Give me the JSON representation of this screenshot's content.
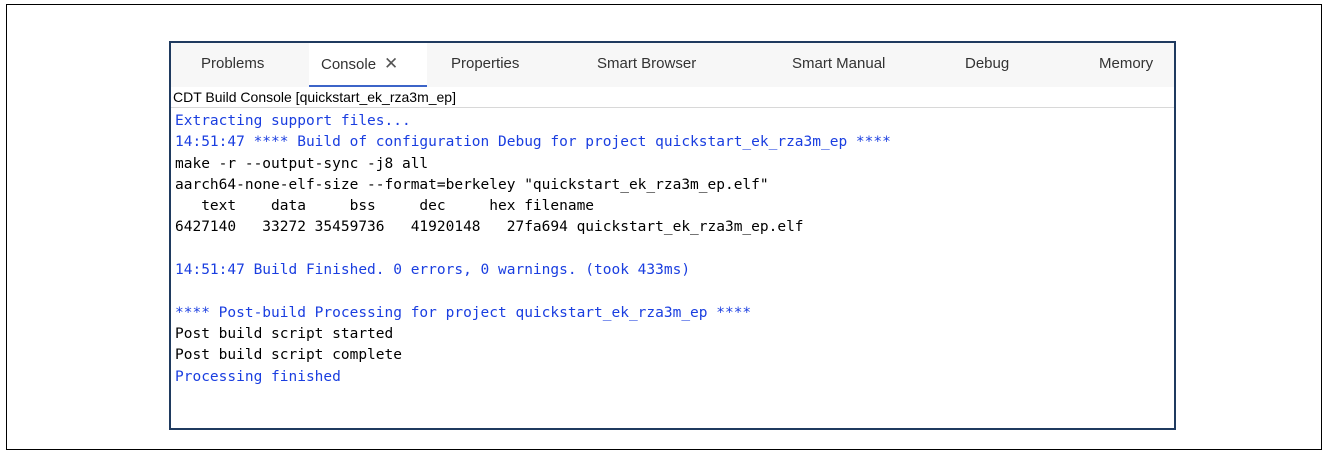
{
  "tabs": [
    {
      "label": "Problems",
      "active": false
    },
    {
      "label": "Console",
      "active": true
    },
    {
      "label": "Properties",
      "active": false
    },
    {
      "label": "Smart Browser",
      "active": false
    },
    {
      "label": "Smart Manual",
      "active": false
    },
    {
      "label": "Debug",
      "active": false
    },
    {
      "label": "Memory",
      "active": false
    }
  ],
  "tab_close_glyph": "✕",
  "console_title": "CDT Build Console [quickstart_ek_rza3m_ep]",
  "output_lines": [
    {
      "text": "Extracting support files...",
      "style": "info"
    },
    {
      "text": "14:51:47 **** Build of configuration Debug for project quickstart_ek_rza3m_ep ****",
      "style": "info"
    },
    {
      "text": "make -r --output-sync -j8 all",
      "style": "normal"
    },
    {
      "text": "aarch64-none-elf-size --format=berkeley \"quickstart_ek_rza3m_ep.elf\"",
      "style": "normal"
    },
    {
      "text": "   text    data     bss     dec     hex filename",
      "style": "normal"
    },
    {
      "text": "6427140   33272 35459736   41920148   27fa694 quickstart_ek_rza3m_ep.elf",
      "style": "normal"
    },
    {
      "text": "",
      "style": "normal"
    },
    {
      "text": "14:51:47 Build Finished. 0 errors, 0 warnings. (took 433ms)",
      "style": "info"
    },
    {
      "text": "",
      "style": "normal"
    },
    {
      "text": "**** Post-build Processing for project quickstart_ek_rza3m_ep ****",
      "style": "info"
    },
    {
      "text": "Post build script started",
      "style": "normal"
    },
    {
      "text": "Post build script complete",
      "style": "normal"
    },
    {
      "text": "Processing finished",
      "style": "info"
    }
  ],
  "colors": {
    "info_text": "#1a3ee0",
    "normal_text": "#000000",
    "active_tab_underline": "#3c64c8",
    "window_border": "#1f3a5f"
  }
}
